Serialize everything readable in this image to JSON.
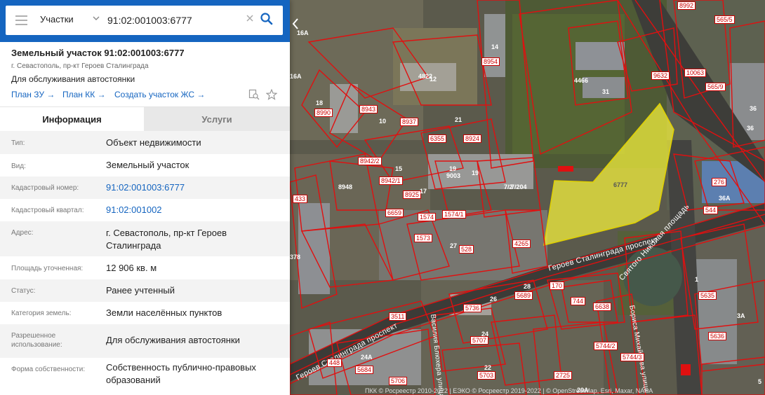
{
  "search": {
    "layer": "Участки",
    "query": "91:02:001003:6777"
  },
  "object": {
    "title": "Земельный участок 91:02:001003:6777",
    "address_short": "г. Севастополь, пр-кт Героев Сталинграда",
    "purpose": "Для обслуживания автостоянки",
    "links": [
      "План ЗУ →",
      "План КК →",
      "Создать участок ЖС →"
    ]
  },
  "tabs": {
    "info": "Информация",
    "services": "Услуги"
  },
  "info": [
    {
      "label": "Тип:",
      "value": "Объект недвижимости"
    },
    {
      "label": "Вид:",
      "value": "Земельный участок"
    },
    {
      "label": "Кадастровый номер:",
      "value": "91:02:001003:6777"
    },
    {
      "label": "Кадастровый квартал:",
      "value": "91:02:001002"
    },
    {
      "label": "Адрес:",
      "value": "г. Севастополь, пр-кт Героев Сталинграда"
    },
    {
      "label": "Площадь уточненная:",
      "value": "12 906 кв. м"
    },
    {
      "label": "Статус:",
      "value": "Ранее учтенный"
    },
    {
      "label": "Категория земель:",
      "value": "Земли населённых пунктов"
    },
    {
      "label": "Разрешенное использование:",
      "value": "Для обслуживания автостоянки"
    },
    {
      "label": "Форма собственности:",
      "value": "Собственность публично-правовых образований"
    }
  ],
  "map": {
    "highlight_label": "6777",
    "highlight_color": "#f2ef3c",
    "boundary_color": "#e01010",
    "streets": [
      "Героев Сталинграда проспект",
      "Святого Николая площадь",
      "Василия Блюхера улица",
      "Бориса Михайлова улица",
      "Героев Сталинграда проспект"
    ],
    "parcel_numbers": [
      "8992",
      "565/5",
      "16А",
      "14",
      "8954",
      "9632",
      "4466",
      "31",
      "36",
      "16А",
      "4822",
      "12",
      "10063",
      "565/9",
      "8990",
      "8943",
      "10",
      "8937",
      "6355",
      "21",
      "8924",
      "36",
      "18",
      "8942/2",
      "15",
      "8942/1",
      "9003",
      "19",
      "19",
      "7/2",
      "7/204",
      "276",
      "8948",
      "8925",
      "17",
      "433",
      "6659",
      "1574",
      "1574/1",
      "544",
      "36А",
      "1573",
      "27",
      "528",
      "4265",
      "378",
      "170",
      "744",
      "6638",
      "28",
      "5689",
      "26",
      "5736",
      "1",
      "5635",
      "3511",
      "24",
      "5707",
      "5636",
      "3А",
      "448",
      "24А",
      "5684",
      "22",
      "5703",
      "5744/2",
      "5744/3",
      "2725",
      "20А",
      "5706",
      "5"
    ],
    "copyright": "ПКК © Росреестр 2010-2022 | ЕЭКО © Росреестр 2019-2022 | © OpenStreetMap, Esri, Maxar, NASA"
  }
}
